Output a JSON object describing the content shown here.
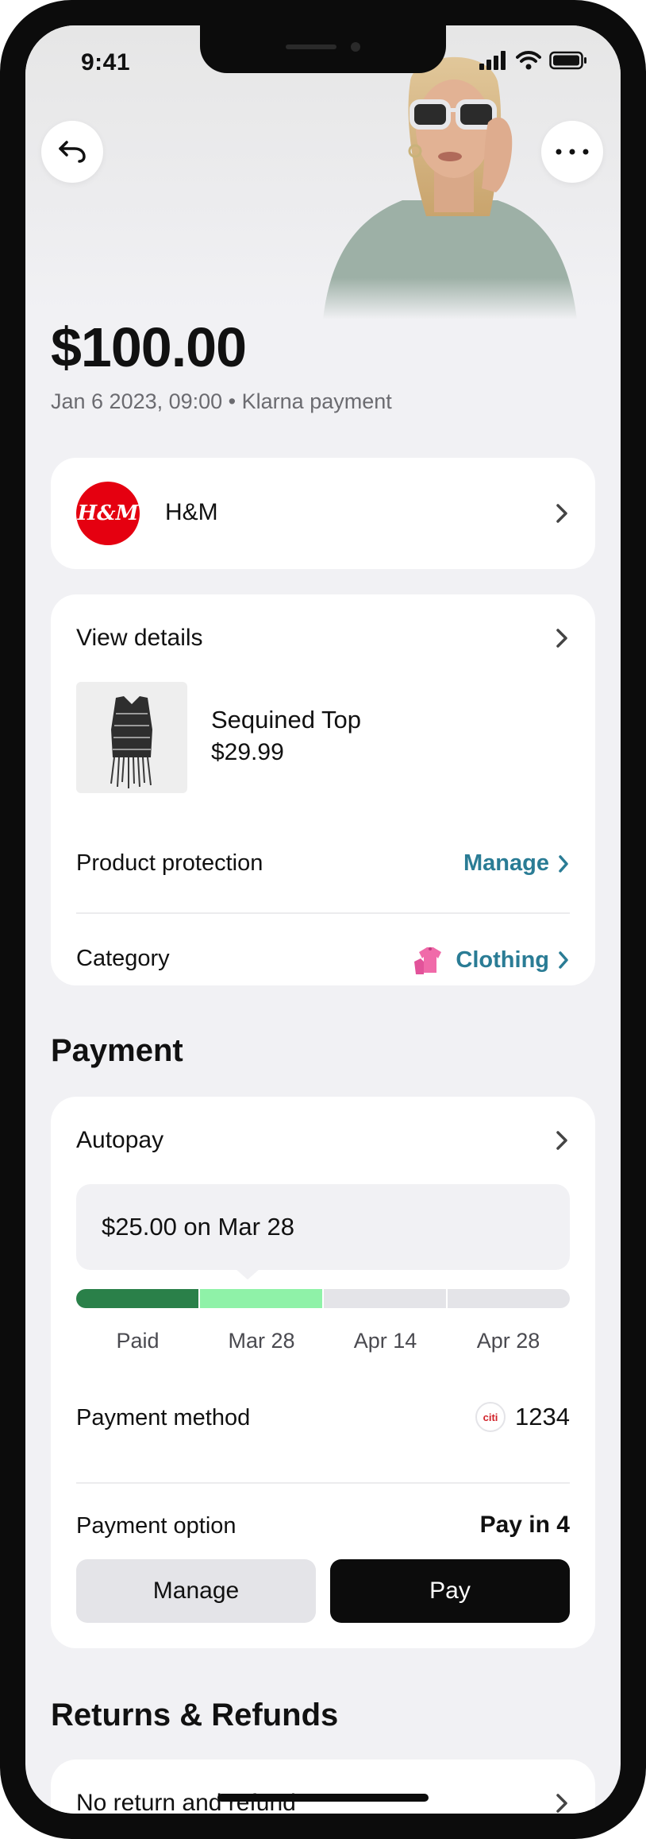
{
  "status_bar": {
    "time": "9:41"
  },
  "header": {
    "back_icon": "back-arrow-icon",
    "more_icon": "more-horizontal-icon"
  },
  "transaction": {
    "amount": "$100.00",
    "subline": "Jan 6 2023, 09:00 • Klarna payment"
  },
  "merchant": {
    "logo_text": "H&M",
    "name": "H&M",
    "logo_color": "#e50010"
  },
  "details": {
    "title": "View details",
    "product": {
      "name": "Sequined Top",
      "price": "$29.99"
    },
    "protection": {
      "label": "Product protection",
      "link": "Manage"
    },
    "category": {
      "label": "Category",
      "link": "Clothing",
      "icon": "clothing-icon"
    }
  },
  "payment": {
    "section_title": "Payment",
    "autopay_label": "Autopay",
    "next_payment": "$25.00 on Mar 28",
    "schedule": [
      {
        "label": "Paid",
        "state": "paid",
        "color": "#2a8049"
      },
      {
        "label": "Mar 28",
        "state": "next",
        "color": "#8ff2a8"
      },
      {
        "label": "Apr 14",
        "state": "upcoming",
        "color": "#e4e4e8"
      },
      {
        "label": "Apr 28",
        "state": "upcoming",
        "color": "#e4e4e8"
      }
    ],
    "method": {
      "label": "Payment method",
      "brand_text": "citi",
      "last4": "1234"
    },
    "option": {
      "label": "Payment option",
      "value": "Pay in 4"
    },
    "manage_button": "Manage",
    "pay_button": "Pay"
  },
  "returns": {
    "section_title": "Returns & Refunds",
    "item": "No return and refund"
  },
  "colors": {
    "accent_link": "#2a7c95",
    "background": "#f1f1f4",
    "primary_button": "#0c0c0c"
  }
}
